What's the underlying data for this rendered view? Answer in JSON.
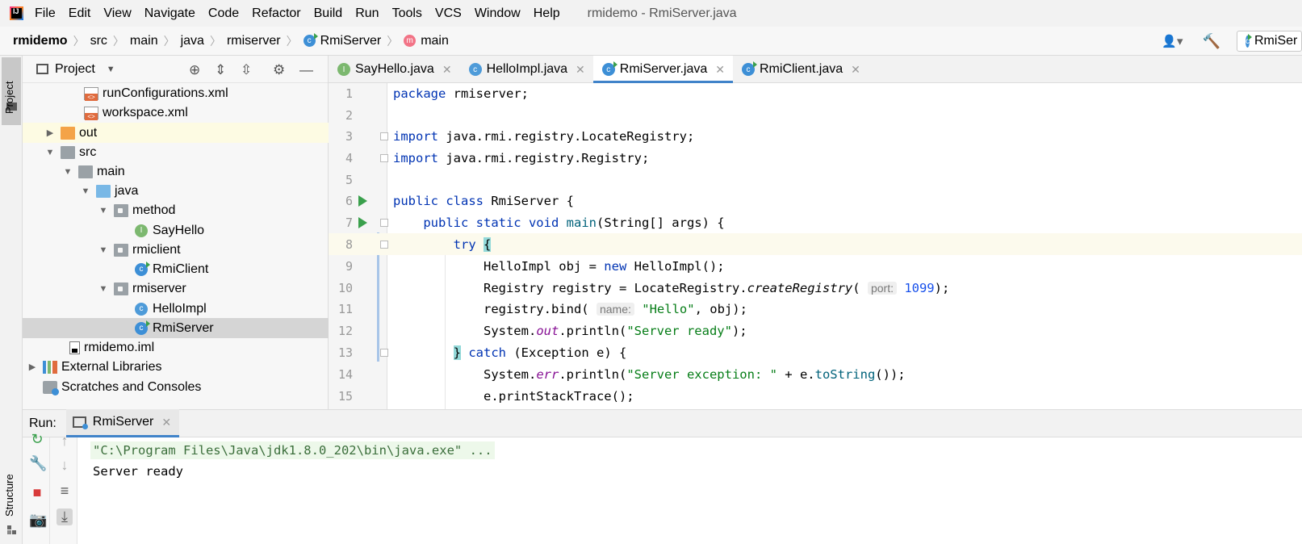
{
  "menubar": {
    "items": [
      "File",
      "Edit",
      "View",
      "Navigate",
      "Code",
      "Refactor",
      "Build",
      "Run",
      "Tools",
      "VCS",
      "Window",
      "Help"
    ],
    "window_title": "rmidemo - RmiServer.java"
  },
  "breadcrumb": {
    "items": [
      "rmidemo",
      "src",
      "main",
      "java",
      "rmiserver",
      "RmiServer",
      "main"
    ],
    "run_config": "RmiSer"
  },
  "stripe": {
    "project_label": "Project",
    "structure_label": "Structure"
  },
  "project_panel": {
    "title": "Project",
    "tree": [
      {
        "label": "runConfigurations.xml",
        "icon": "xml-file-icon"
      },
      {
        "label": "workspace.xml",
        "icon": "xml-file-icon"
      },
      {
        "label": "out",
        "icon": "folder-icon",
        "expanded": false
      },
      {
        "label": "src",
        "icon": "folder-icon",
        "expanded": true
      },
      {
        "label": "main",
        "icon": "folder-icon",
        "expanded": true
      },
      {
        "label": "java",
        "icon": "source-folder-icon",
        "expanded": true
      },
      {
        "label": "method",
        "icon": "package-icon",
        "expanded": true
      },
      {
        "label": "SayHello",
        "icon": "interface-icon"
      },
      {
        "label": "rmiclient",
        "icon": "package-icon",
        "expanded": true
      },
      {
        "label": "RmiClient",
        "icon": "class-icon"
      },
      {
        "label": "rmiserver",
        "icon": "package-icon",
        "expanded": true
      },
      {
        "label": "HelloImpl",
        "icon": "class-icon"
      },
      {
        "label": "RmiServer",
        "icon": "class-icon",
        "selected": true
      },
      {
        "label": "rmidemo.iml",
        "icon": "iml-file-icon"
      },
      {
        "label": "External Libraries",
        "icon": "library-icon",
        "expanded": false
      },
      {
        "label": "Scratches and Consoles",
        "icon": "scratch-icon"
      }
    ]
  },
  "editor_tabs": [
    {
      "label": "SayHello.java",
      "icon": "interface-icon"
    },
    {
      "label": "HelloImpl.java",
      "icon": "class-icon"
    },
    {
      "label": "RmiServer.java",
      "icon": "class-icon",
      "active": true
    },
    {
      "label": "RmiClient.java",
      "icon": "class-icon"
    }
  ],
  "editor": {
    "line_numbers": [
      "1",
      "2",
      "3",
      "4",
      "5",
      "6",
      "7",
      "8",
      "9",
      "10",
      "11",
      "12",
      "13",
      "14",
      "15"
    ],
    "current_line": 8,
    "code": {
      "l1_kw": "package",
      "l1_rest": " rmiserver;",
      "l3_kw": "import",
      "l3_rest": " java.rmi.registry.LocateRegistry;",
      "l4_kw": "import",
      "l4_rest": " java.rmi.registry.Registry;",
      "l6_kw": "public class",
      "l6_rest": " RmiServer {",
      "l7_kw": "public static void",
      "l7_mth": "main",
      "l7_rest": "(String[] args) {",
      "l8_kw": "try",
      "l8_brace": "{",
      "l9_a": "HelloImpl obj = ",
      "l9_kw": "new",
      "l9_b": " HelloImpl();",
      "l10_a": "Registry registry = LocateRegistry.",
      "l10_itl": "createRegistry",
      "l10_b": "(",
      "l10_hint": "port:",
      "l10_num": "1099",
      "l10_c": ");",
      "l11_a": "registry.bind(",
      "l11_hint": "name:",
      "l11_str": "\"Hello\"",
      "l11_b": ", obj);",
      "l12_a": "System.",
      "l12_fld": "out",
      "l12_b": ".println(",
      "l12_str": "\"Server ready\"",
      "l12_c": ");",
      "l13_brace": "}",
      "l13_kw": "catch",
      "l13_rest": " (Exception e) {",
      "l14_a": "System.",
      "l14_fld": "err",
      "l14_b": ".println(",
      "l14_str": "\"Server exception: \"",
      "l14_c": " + e.",
      "l14_inv": "toString",
      "l14_d": "());",
      "l15_a": "e.printStackTrace();"
    }
  },
  "run_panel": {
    "label": "Run:",
    "tab_label": "RmiServer",
    "console_command": "\"C:\\Program Files\\Java\\jdk1.8.0_202\\bin\\java.exe\" ...",
    "console_output": "Server ready"
  }
}
